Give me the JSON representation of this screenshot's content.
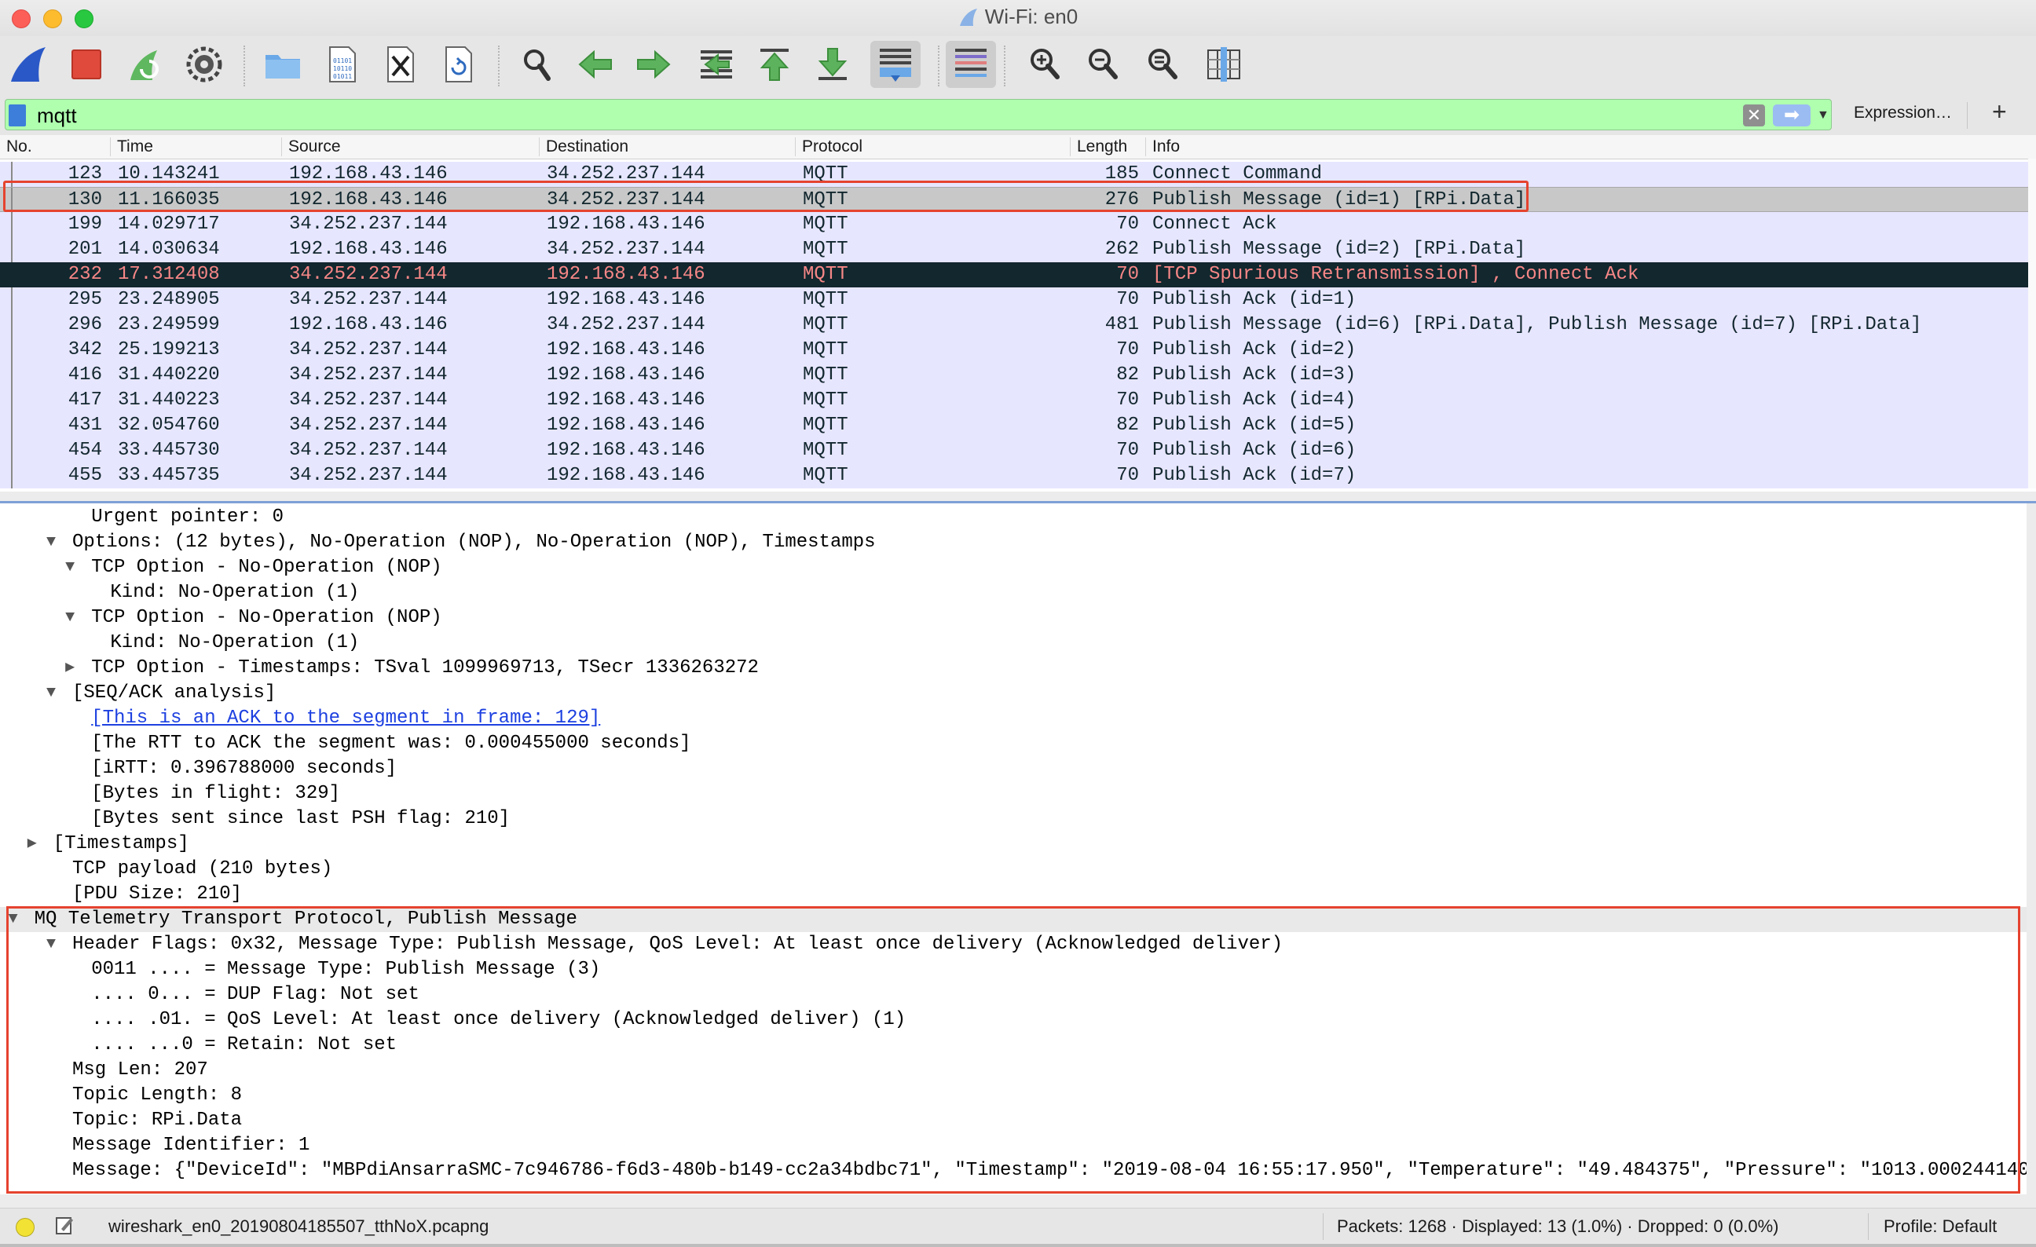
{
  "window": {
    "title": "Wi-Fi: en0"
  },
  "toolbar": {
    "buttons": [
      "start-capture",
      "stop-capture",
      "restart-capture",
      "capture-options",
      "open-file",
      "save-file",
      "close-file",
      "reload-file",
      "find-packet",
      "go-back",
      "go-forward",
      "go-to-packet",
      "go-first",
      "go-last",
      "autoscroll",
      "colorize",
      "zoom-in",
      "zoom-out",
      "normal-size",
      "resize-columns"
    ]
  },
  "filter": {
    "value": "mqtt",
    "expression_label": "Expression…",
    "add_label": "+",
    "clear_label": "✕",
    "apply_label": "➡",
    "bg_color": "#afffaf"
  },
  "packet_list": {
    "columns": [
      "No.",
      "Time",
      "Source",
      "Destination",
      "Protocol",
      "Length",
      "Info"
    ],
    "rows": [
      {
        "no": "123",
        "time": "10.143241",
        "src": "192.168.43.146",
        "dst": "34.252.237.144",
        "proto": "MQTT",
        "len": "185",
        "info": "Connect Command"
      },
      {
        "no": "130",
        "time": "11.166035",
        "src": "192.168.43.146",
        "dst": "34.252.237.144",
        "proto": "MQTT",
        "len": "276",
        "info": "Publish Message (id=1) [RPi.Data]"
      },
      {
        "no": "199",
        "time": "14.029717",
        "src": "34.252.237.144",
        "dst": "192.168.43.146",
        "proto": "MQTT",
        "len": "70",
        "info": "Connect Ack"
      },
      {
        "no": "201",
        "time": "14.030634",
        "src": "192.168.43.146",
        "dst": "34.252.237.144",
        "proto": "MQTT",
        "len": "262",
        "info": "Publish Message (id=2) [RPi.Data]"
      },
      {
        "no": "232",
        "time": "17.312408",
        "src": "34.252.237.144",
        "dst": "192.168.43.146",
        "proto": "MQTT",
        "len": "70",
        "info": "[TCP Spurious Retransmission] , Connect Ack"
      },
      {
        "no": "295",
        "time": "23.248905",
        "src": "34.252.237.144",
        "dst": "192.168.43.146",
        "proto": "MQTT",
        "len": "70",
        "info": "Publish Ack (id=1)"
      },
      {
        "no": "296",
        "time": "23.249599",
        "src": "192.168.43.146",
        "dst": "34.252.237.144",
        "proto": "MQTT",
        "len": "481",
        "info": "Publish Message (id=6) [RPi.Data], Publish Message (id=7) [RPi.Data]"
      },
      {
        "no": "342",
        "time": "25.199213",
        "src": "34.252.237.144",
        "dst": "192.168.43.146",
        "proto": "MQTT",
        "len": "70",
        "info": "Publish Ack (id=2)"
      },
      {
        "no": "416",
        "time": "31.440220",
        "src": "34.252.237.144",
        "dst": "192.168.43.146",
        "proto": "MQTT",
        "len": "82",
        "info": "Publish Ack (id=3)"
      },
      {
        "no": "417",
        "time": "31.440223",
        "src": "34.252.237.144",
        "dst": "192.168.43.146",
        "proto": "MQTT",
        "len": "70",
        "info": "Publish Ack (id=4)"
      },
      {
        "no": "431",
        "time": "32.054760",
        "src": "34.252.237.144",
        "dst": "192.168.43.146",
        "proto": "MQTT",
        "len": "82",
        "info": "Publish Ack (id=5)"
      },
      {
        "no": "454",
        "time": "33.445730",
        "src": "34.252.237.144",
        "dst": "192.168.43.146",
        "proto": "MQTT",
        "len": "70",
        "info": "Publish Ack (id=6)"
      },
      {
        "no": "455",
        "time": "33.445735",
        "src": "34.252.237.144",
        "dst": "192.168.43.146",
        "proto": "MQTT",
        "len": "70",
        "info": "Publish Ack (id=7)"
      }
    ]
  },
  "details": {
    "lines": [
      {
        "text": "Urgent pointer: 0",
        "toggle": ""
      },
      {
        "text": "Options: (12 bytes), No-Operation (NOP), No-Operation (NOP), Timestamps",
        "toggle": "▼"
      },
      {
        "text": "TCP Option - No-Operation (NOP)",
        "toggle": "▼"
      },
      {
        "text": "Kind: No-Operation (1)",
        "toggle": ""
      },
      {
        "text": "TCP Option - No-Operation (NOP)",
        "toggle": "▼"
      },
      {
        "text": "Kind: No-Operation (1)",
        "toggle": ""
      },
      {
        "text": "TCP Option - Timestamps: TSval 1099969713, TSecr 1336263272",
        "toggle": "▶"
      },
      {
        "text": "[SEQ/ACK analysis]",
        "toggle": "▼"
      },
      {
        "text": "[This is an ACK to the segment in frame: 129]",
        "toggle": ""
      },
      {
        "text": "[The RTT to ACK the segment was: 0.000455000 seconds]",
        "toggle": ""
      },
      {
        "text": "[iRTT: 0.396788000 seconds]",
        "toggle": ""
      },
      {
        "text": "[Bytes in flight: 329]",
        "toggle": ""
      },
      {
        "text": "[Bytes sent since last PSH flag: 210]",
        "toggle": ""
      },
      {
        "text": "[Timestamps]",
        "toggle": "▶"
      },
      {
        "text": "TCP payload (210 bytes)",
        "toggle": ""
      },
      {
        "text": "[PDU Size: 210]",
        "toggle": ""
      },
      {
        "text": "MQ Telemetry Transport Protocol, Publish Message",
        "toggle": "▼"
      },
      {
        "text": "Header Flags: 0x32, Message Type: Publish Message, QoS Level: At least once delivery (Acknowledged deliver)",
        "toggle": "▼"
      },
      {
        "text": "0011 .... = Message Type: Publish Message (3)",
        "toggle": ""
      },
      {
        "text": ".... 0... = DUP Flag: Not set",
        "toggle": ""
      },
      {
        "text": ".... .01. = QoS Level: At least once delivery (Acknowledged deliver) (1)",
        "toggle": ""
      },
      {
        "text": ".... ...0 = Retain: Not set",
        "toggle": ""
      },
      {
        "text": "Msg Len: 207",
        "toggle": ""
      },
      {
        "text": "Topic Length: 8",
        "toggle": ""
      },
      {
        "text": "Topic: RPi.Data",
        "toggle": ""
      },
      {
        "text": "Message Identifier: 1",
        "toggle": ""
      },
      {
        "text": "Message: {\"DeviceId\": \"MBPdiAnsarraSMC-7c946786-f6d3-480b-b149-cc2a34bdbc71\", \"Timestamp\": \"2019-08-04 16:55:17.950\", \"Temperature\": \"49.484375\", \"Pressure\": \"1013.000244140",
        "toggle": ""
      }
    ]
  },
  "status": {
    "file": "wireshark_en0_20190804185507_tthNoX.pcapng",
    "packets": "Packets: 1268 · Displayed: 13 (1.0%) · Dropped: 0 (0.0%)",
    "profile": "Profile: Default"
  },
  "colors": {
    "mqtt_row": "#e7e6ff",
    "selected_row": "#c8c8c8",
    "bad_tcp_bg": "#12272e",
    "bad_tcp_fg": "#f78787",
    "annotation_red": "#e5432f"
  }
}
